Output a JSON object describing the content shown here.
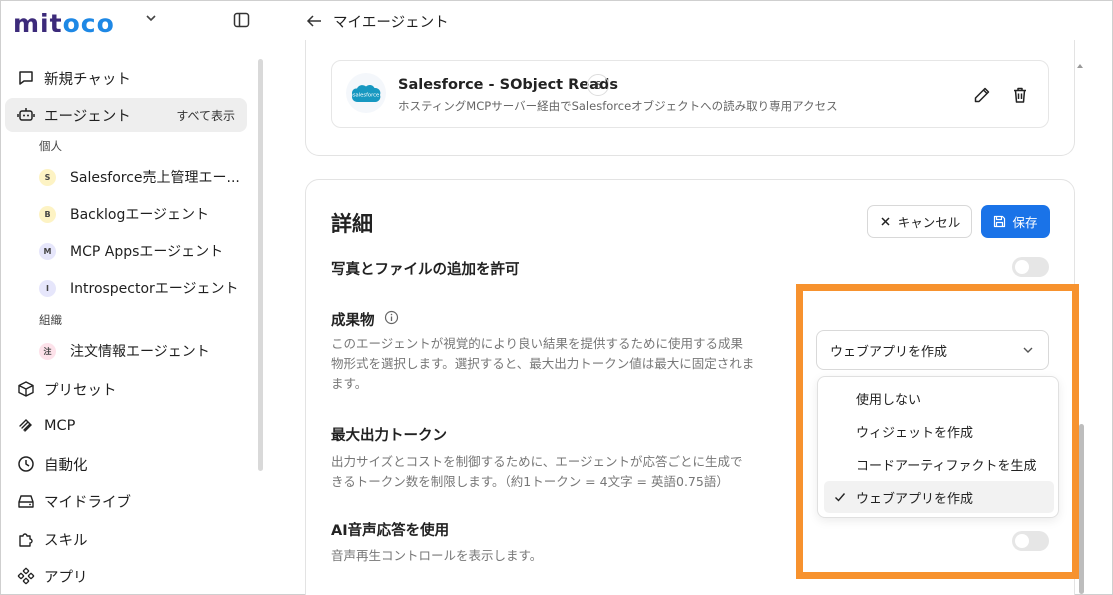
{
  "sidebar": {
    "logo": {
      "part1": "mit",
      "o1": "o",
      "c": "c",
      "o2": "o"
    },
    "nav_top": [
      {
        "label": "新規チャット",
        "icon": "chat-icon"
      },
      {
        "label": "エージェント",
        "icon": "robot-icon",
        "right_label": "すべて表示"
      }
    ],
    "personal_label": "個人",
    "personal_agents": [
      {
        "label": "Salesforce売上管理エー...",
        "initial": "S",
        "color": "#fdf3c4"
      },
      {
        "label": "Backlogエージェント",
        "initial": "B",
        "color": "#fdf3c4"
      },
      {
        "label": "MCP Appsエージェント",
        "initial": "M",
        "color": "#e6e6fb"
      },
      {
        "label": "Introspectorエージェント",
        "initial": "I",
        "color": "#e6e6fb"
      }
    ],
    "org_label": "組織",
    "org_agents": [
      {
        "label": "注文情報エージェント",
        "initial": "注",
        "color": "#fde2ea"
      }
    ],
    "nav_bottom": [
      {
        "label": "プリセット",
        "icon": "box-icon"
      },
      {
        "label": "MCP",
        "icon": "mcp-icon"
      },
      {
        "label": "自動化",
        "icon": "clock-icon"
      },
      {
        "label": "マイドライブ",
        "icon": "drive-icon"
      },
      {
        "label": "スキル",
        "icon": "puzzle-icon"
      },
      {
        "label": "アプリ",
        "icon": "apps-icon"
      }
    ]
  },
  "header": {
    "title": "マイエージェント"
  },
  "tool": {
    "name": "Salesforce - SObject Reads",
    "count": "6",
    "description": "ホスティングMCPサーバー経由でSalesforceオブジェクトへの読み取り専用アクセス",
    "logo_text": "salesforce"
  },
  "details": {
    "title": "詳細",
    "cancel_label": "キャンセル",
    "save_label": "保存",
    "photo_files": {
      "title": "写真とファイルの追加を許可",
      "enabled": false
    },
    "artifacts": {
      "title": "成果物",
      "description_lines": [
        "このエージェントが視覚的により良い結果を提供するために使用する成果",
        "物形式を選択します。選択すると、最大出力トークン値は最大に固定されま",
        "ます。"
      ],
      "selected": "ウェブアプリを作成",
      "options": [
        "使用しない",
        "ウィジェットを作成",
        "コードアーティファクトを生成",
        "ウェブアプリを作成"
      ]
    },
    "max_tokens": {
      "title": "最大出力トークン",
      "description_lines": [
        "出力サイズとコストを制御するために、エージェントが応答ごとに生成で",
        "きるトークン数を制限します。（約1トークン = 4文字 = 英語0.75語）"
      ]
    },
    "voice": {
      "title": "AI音声応答を使用",
      "description": "音声再生コントロールを表示します。",
      "enabled": false
    }
  },
  "colors": {
    "accent": "#1a73e8",
    "highlight": "#f7922e",
    "logo_purple": "#3c2a7a",
    "logo_blue": "#1e88e5"
  }
}
